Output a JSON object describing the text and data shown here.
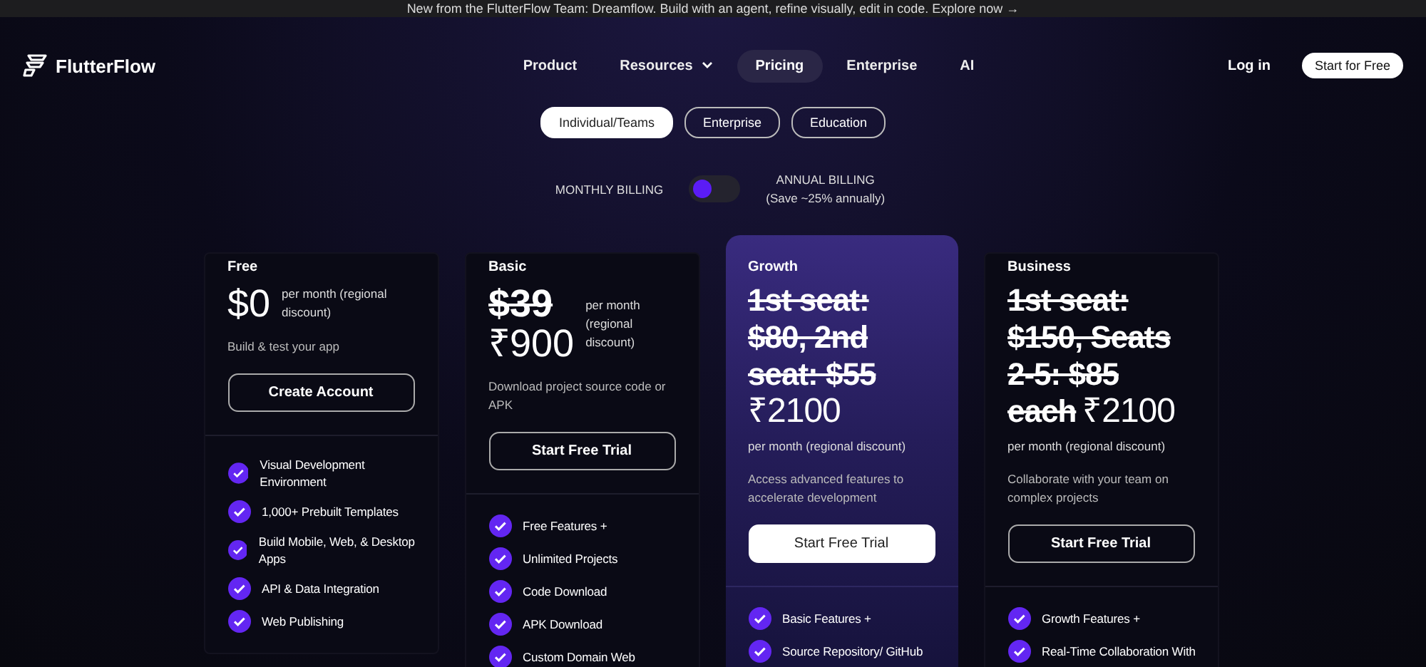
{
  "banner": {
    "text": "New from the FlutterFlow Team: Dreamflow. Build with an agent, refine visually, edit in code. Explore now →"
  },
  "nav": {
    "brand": "FlutterFlow",
    "items": [
      {
        "label": "Product",
        "selected": false,
        "dropdown": false
      },
      {
        "label": "Resources",
        "selected": false,
        "dropdown": true
      },
      {
        "label": "Pricing",
        "selected": true,
        "dropdown": false
      },
      {
        "label": "Enterprise",
        "selected": false,
        "dropdown": false
      },
      {
        "label": "AI",
        "selected": false,
        "dropdown": false
      }
    ],
    "login": "Log in",
    "cta": "Start for Free"
  },
  "segments": [
    {
      "label": "Individual/Teams",
      "selected": true
    },
    {
      "label": "Enterprise",
      "selected": false
    },
    {
      "label": "Education",
      "selected": false
    }
  ],
  "billing": {
    "monthly": "MONTHLY BILLING",
    "annual": "ANNUAL BILLING",
    "annual_note": "(Save ~25% annually)",
    "annual_on": false
  },
  "plans": [
    {
      "name": "Free",
      "kind": "aside",
      "featured": false,
      "price": "$0",
      "note": "per month (regional discount)",
      "desc": "Build & test your app",
      "button": "Create Account",
      "features": [
        "Visual Development Environment",
        "1,000+ Prebuilt Templates",
        "Build Mobile, Web, & Desktop Apps",
        "API & Data Integration",
        "Web Publishing"
      ]
    },
    {
      "name": "Basic",
      "kind": "aside",
      "featured": false,
      "old_price": "$39",
      "price": "₹900",
      "note": "per month (regional discount)",
      "desc": "Download project source code or APK",
      "button": "Start Free Trial",
      "features": [
        "Free Features +",
        "Unlimited Projects",
        "Code Download",
        "APK Download",
        "Custom Domain Web"
      ]
    },
    {
      "name": "Growth",
      "kind": "below",
      "featured": true,
      "old_price": "1st seat: $80, 2nd seat: $55",
      "price": "₹2100",
      "note": "per month (regional discount)",
      "desc": "Access advanced features to accelerate development",
      "button": "Start Free Trial",
      "features": [
        "Basic Features +",
        "Source Repository/ GitHub"
      ]
    },
    {
      "name": "Business",
      "kind": "below",
      "featured": false,
      "old_price": "1st seat: $150, Seats 2-5: $85 each",
      "price": "₹2100",
      "note": "per month (regional discount)",
      "desc": "Collaborate with your team on complex projects",
      "button": "Start Free Trial",
      "features": [
        "Growth Features +",
        "Real-Time Collaboration With"
      ]
    }
  ]
}
